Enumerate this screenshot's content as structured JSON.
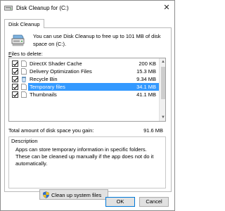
{
  "window": {
    "title": "Disk Cleanup for  (C:)",
    "close_glyph": "✕",
    "tab_label": "Disk Cleanup"
  },
  "intro": {
    "text": "You can use Disk Cleanup to free up to 101 MB of disk space on  (C:)."
  },
  "files": {
    "label_prefix": "",
    "label_underlined": "F",
    "label_rest": "iles to delete:",
    "items": [
      {
        "name": "DirectX Shader Cache",
        "size": "200 KB",
        "checked": true,
        "selected": false
      },
      {
        "name": "Delivery Optimization Files",
        "size": "15.3 MB",
        "checked": true,
        "selected": false
      },
      {
        "name": "Recycle Bin",
        "size": "9.34 MB",
        "checked": true,
        "selected": false
      },
      {
        "name": "Temporary files",
        "size": "34.1 MB",
        "checked": true,
        "selected": true
      },
      {
        "name": "Thumbnails",
        "size": "41.1 MB",
        "checked": true,
        "selected": false
      }
    ]
  },
  "total": {
    "label": "Total amount of disk space you gain:",
    "value": "91.6 MB"
  },
  "description": {
    "title": "Description",
    "text": "Apps can store temporary information in specific folders. These can be cleaned up manually if the app does not do it automatically."
  },
  "buttons": {
    "cleanup_system_files": "Clean up system files",
    "ok": "OK",
    "cancel": "Cancel"
  },
  "colors": {
    "selection": "#3399ff",
    "button_face": "#e1e1e1",
    "default_button_border": "#0078d7"
  },
  "icons": {
    "app": "disk-cleanup-icon",
    "drive": "hard-drive-icon",
    "shield": "uac-shield-icon"
  }
}
